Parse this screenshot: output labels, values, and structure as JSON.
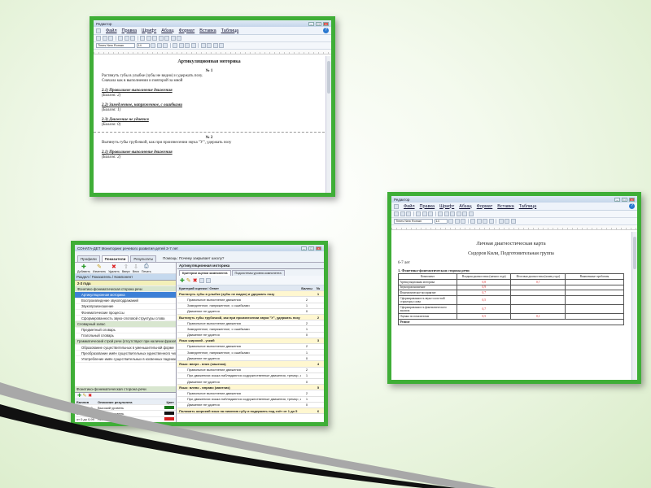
{
  "colors": {
    "frame": "#3fae37",
    "stripe_black": "#111111",
    "stripe_gray": "#a0a0a0"
  },
  "winA": {
    "title": "Редактор",
    "menu": [
      "Файл",
      "Правка",
      "Шрифт",
      "Абзац",
      "Формат",
      "Вставка",
      "Таблица"
    ],
    "font_name": "Times New Roman",
    "font_size": "14",
    "doc": {
      "heading": "Артикуляционная моторика",
      "blocks": [
        {
          "num": "№ 1",
          "task": "Растянуть губы в улыбке (зубы не видно) и удержать позу.",
          "task2": "Сначала как в выполнении и повторой за мной",
          "items": [
            {
              "label": "2.1) Правильное выполнение движения",
              "score": "(Баллов: 2)"
            },
            {
              "label": "2.2) Замедленное, напряженное, с ошибками",
              "score": "(Баллов: 1)"
            },
            {
              "label": "2.3) Движение не удается",
              "score": "(Баллов: 0)"
            }
          ]
        },
        {
          "num": "№ 2",
          "task": "Вытянуть губы трубочкой, как при произнесении звука \"У\", удержать позу",
          "task2": "",
          "items": [
            {
              "label": "2.1) Правильное выполнение движения",
              "score": "(Баллов: 2)"
            }
          ]
        }
      ]
    }
  },
  "winB": {
    "title": "Редактор",
    "menu": [
      "Файл",
      "Правка",
      "Шрифт",
      "Абзац",
      "Формат",
      "Вставка",
      "Таблица"
    ],
    "font_name": "Times New Roman",
    "font_size": "14",
    "doc": {
      "title": "Личная диагностическая карта",
      "name_line": "Сидоров Кили, Подготовительная группа",
      "age": "6-7 лет",
      "section": "1. Фонетико-фонематическая сторона речи",
      "table_headers": [
        "Компонент",
        "Входная диагностика (начало года)",
        "Итоговая диагностика (конец года)",
        "Выявленные проблемы"
      ],
      "rows": [
        {
          "name": "Артикуляционная моторика",
          "start": "0,8",
          "end": "0,7"
        },
        {
          "name": "Звукопроизношение",
          "start": "0,9",
          "end": ""
        },
        {
          "name": "Фонематическое восприятие",
          "start": "0,7",
          "end": ""
        },
        {
          "name": "Сформированность звуко-слого-вой структуры слова",
          "start": "0,5",
          "end": ""
        },
        {
          "name": "Сформированность фонематического анализа",
          "start": "0,7",
          "end": ""
        },
        {
          "name": "Оценка по показателям",
          "start": "0,5",
          "end": "0,1"
        }
      ],
      "footer": "Резюме"
    }
  },
  "winC": {
    "title": "СОНАТА-ДЕТ Мониторинг речевого развития детей 3-7 лет",
    "tabs": [
      "Профили",
      "Показатели",
      "Результаты"
    ],
    "help_hint": "Помощь: Почему закрывает школу?",
    "toolbar_labels": [
      "Добавить",
      "Изменить",
      "Удалить",
      "Вверх",
      "Вниз",
      "Печать"
    ],
    "breadcrumb": "Раздел / Показатель / Компонент",
    "left_items": [
      {
        "text": "2-3 года",
        "kind": "grp"
      },
      {
        "text": "Фонетико-фонематическая сторона речи",
        "kind": "cat"
      },
      {
        "text": "Артикуляционная моторика",
        "kind": "sel"
      },
      {
        "text": "Воспроизведение звукоподражаний",
        "kind": ""
      },
      {
        "text": "Звукопроизношение",
        "kind": ""
      },
      {
        "text": "Фонематические процессы",
        "kind": ""
      },
      {
        "text": "Сформированность звуко-слоговой структуры слова",
        "kind": ""
      },
      {
        "text": "Словарный запас",
        "kind": "cat"
      },
      {
        "text": "Предметный словарь",
        "kind": ""
      },
      {
        "text": "Глагольный словарь",
        "kind": ""
      },
      {
        "text": "Грамматический строй речи (отсутствуют при наличии фразовой речи)",
        "kind": "cat"
      },
      {
        "text": "Образование существительных в уменьшительной форме",
        "kind": ""
      },
      {
        "text": "Преобразование имён существительных единственного числа в множественное",
        "kind": ""
      },
      {
        "text": "Употребление имён существительных в косвенных падежах единственного числа без",
        "kind": ""
      }
    ],
    "scale_title": "Фонетико-фонематическая сторона речи",
    "scale_header": [
      "Баллов",
      "Описание результата",
      "Цвет"
    ],
    "scale_rows": [
      {
        "range": "от 1,6 до 2",
        "desc": "Высокий уровень",
        "color": "#1a7a1a"
      },
      {
        "range": "от 1 до 1,59",
        "desc": "Средний уровень",
        "color": "#111111"
      },
      {
        "range": "от 0 до 0,99",
        "desc": "Низкий уровень",
        "color": "#d42020"
      }
    ],
    "right_title": "Артикуляционная моторика",
    "right_tabs": [
      "Критерии оценки компонента",
      "Подсистемы уровня компонента"
    ],
    "right_header": [
      "Критерий оценки / Ответ",
      "Баллы",
      "№"
    ],
    "right_rows": [
      {
        "q": "Растянуть губы в улыбке (зубы не видно) и удержать позу",
        "s": "",
        "n": "1",
        "kind": "grp"
      },
      {
        "q": "Правильное выполнение движения",
        "s": "2",
        "n": "",
        "kind": ""
      },
      {
        "q": "Замедленное, напряженное, с ошибками",
        "s": "1",
        "n": "",
        "kind": ""
      },
      {
        "q": "Движение не удается",
        "s": "0",
        "n": "",
        "kind": ""
      },
      {
        "q": "Вытянуть губы трубочкой, как при произнесении звука \"У\", удержать позу",
        "s": "",
        "n": "2",
        "kind": "grp"
      },
      {
        "q": "Правильное выполнение движения",
        "s": "2",
        "n": "",
        "kind": ""
      },
      {
        "q": "Замедленное, напряженное, с ошибками",
        "s": "1",
        "n": "",
        "kind": ""
      },
      {
        "q": "Движение не удается",
        "s": "0",
        "n": "",
        "kind": ""
      },
      {
        "q": "Язык широкий - узкий",
        "s": "",
        "n": "3",
        "kind": "grp"
      },
      {
        "q": "Правильное выполнение движения",
        "s": "2",
        "n": "",
        "kind": ""
      },
      {
        "q": "Замедленное, напряженное, с ошибками",
        "s": "1",
        "n": "",
        "kind": ""
      },
      {
        "q": "Движение не удается",
        "s": "0",
        "n": "",
        "kind": ""
      },
      {
        "q": "Язык: вверх - вниз (чашечка)",
        "s": "",
        "n": "4",
        "kind": "grp"
      },
      {
        "q": "Правильное выполнение движения",
        "s": "2",
        "n": "",
        "kind": ""
      },
      {
        "q": "При движениях языка наблюдаются содружественные движения, тремор, саливация",
        "s": "1",
        "n": "",
        "kind": ""
      },
      {
        "q": "Движение не удается",
        "s": "0",
        "n": "",
        "kind": ""
      },
      {
        "q": "Язык: влево - вправо (маятник)",
        "s": "",
        "n": "5",
        "kind": "grp"
      },
      {
        "q": "Правильное выполнение движения",
        "s": "2",
        "n": "",
        "kind": ""
      },
      {
        "q": "При движениях языка наблюдаются содружественные движения, тремор, саливация",
        "s": "1",
        "n": "",
        "kind": ""
      },
      {
        "q": "Движение не удается",
        "s": "0",
        "n": "",
        "kind": ""
      },
      {
        "q": "Положить широкий язык на нижнюю губу и подержать под счёт от 1 до 5",
        "s": "",
        "n": "6",
        "kind": "grp"
      }
    ]
  }
}
